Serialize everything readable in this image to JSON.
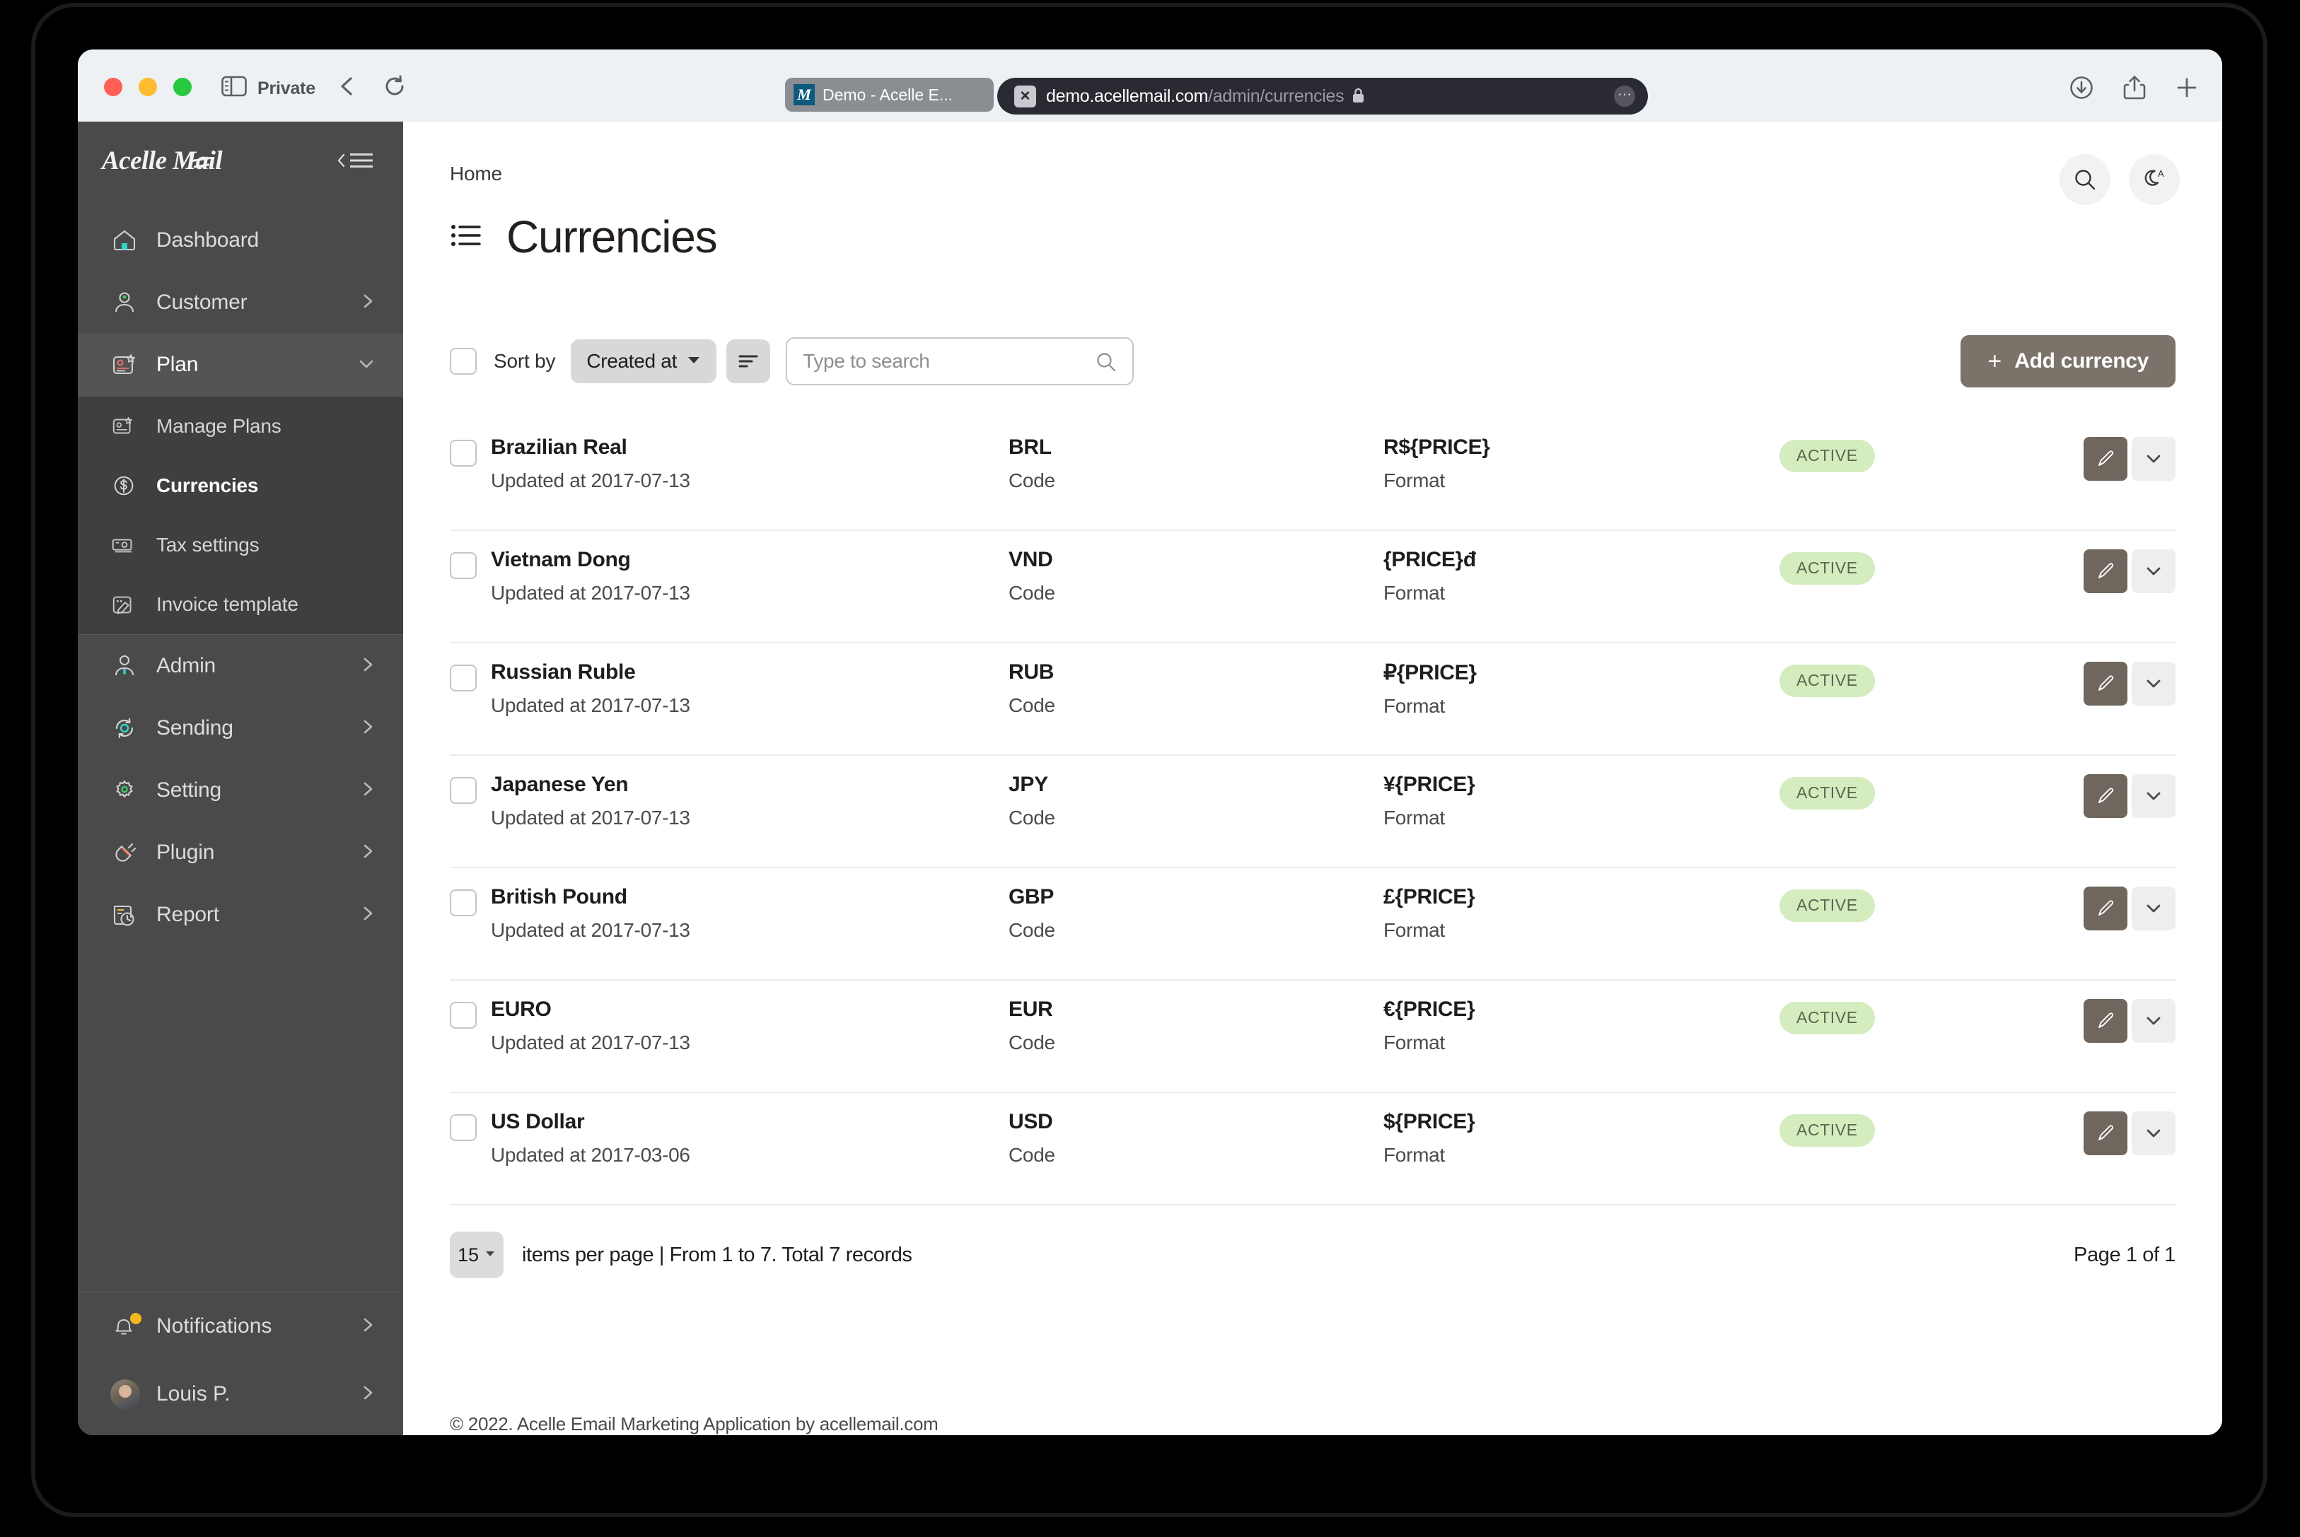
{
  "browser": {
    "private_label": "Private",
    "tab": {
      "favicon_letter": "M",
      "title": "Demo - Acelle E..."
    },
    "url": {
      "domain": "demo.acellemail.com",
      "path": "/admin/currencies"
    },
    "icons": {
      "sidebar_toggle": "sidebar-toggle-icon",
      "back": "back-chevron-icon",
      "reload": "reload-icon",
      "download": "download-icon",
      "share": "share-icon",
      "new_tab": "plus-icon"
    }
  },
  "sidebar": {
    "brand": "Acelle Mail",
    "collapse_icon": "collapse-menu-icon",
    "items": [
      {
        "label": "Dashboard",
        "icon": "home-icon",
        "arrow": ""
      },
      {
        "label": "Customer",
        "icon": "user-icon",
        "arrow": "chevron-right"
      },
      {
        "label": "Plan",
        "icon": "plan-card-icon",
        "arrow": "chevron-down"
      }
    ],
    "sub_items": [
      {
        "label": "Manage Plans",
        "icon": "plan-card-icon"
      },
      {
        "label": "Currencies",
        "icon": "dollar-circle-icon"
      },
      {
        "label": "Tax settings",
        "icon": "banknote-icon"
      },
      {
        "label": "Invoice template",
        "icon": "template-brush-icon"
      }
    ],
    "items_after": [
      {
        "label": "Admin",
        "icon": "admin-user-icon",
        "arrow": "chevron-right"
      },
      {
        "label": "Sending",
        "icon": "sending-sync-icon",
        "arrow": "chevron-right"
      },
      {
        "label": "Setting",
        "icon": "gear-icon",
        "arrow": "chevron-right"
      },
      {
        "label": "Plugin",
        "icon": "plug-icon",
        "arrow": "chevron-right"
      },
      {
        "label": "Report",
        "icon": "report-clock-icon",
        "arrow": "chevron-right"
      }
    ],
    "footer": [
      {
        "label": "Notifications",
        "icon": "bell-icon",
        "arrow": "chevron-right",
        "has_dot": true
      },
      {
        "label": "Louis P.",
        "icon": "avatar",
        "arrow": "chevron-right",
        "has_dot": false
      }
    ]
  },
  "header": {
    "breadcrumb": "Home",
    "title": "Currencies",
    "title_icon": "list-icon",
    "search_icon": "search-icon",
    "theme_icon": "moon-auto-icon"
  },
  "toolbar": {
    "sort_by_label": "Sort by",
    "sort_value": "Created at",
    "sort_direction_icon": "sort-direction-icon",
    "search_placeholder": "Type to search",
    "search_value": "",
    "search_icon": "search-icon",
    "add_button_label": "Add currency",
    "add_button_plus": "+",
    "add_button_color": "#7b7369"
  },
  "list": {
    "labels": {
      "code": "Code",
      "format": "Format",
      "updated_prefix": "Updated at"
    },
    "rows": [
      {
        "name": "Brazilian Real",
        "updated": "Updated at 2017-07-13",
        "code": "BRL",
        "code_label": "Code",
        "format": "R${PRICE}",
        "format_label": "Format",
        "status": "ACTIVE"
      },
      {
        "name": "Vietnam Dong",
        "updated": "Updated at 2017-07-13",
        "code": "VND",
        "code_label": "Code",
        "format": "{PRICE}đ",
        "format_label": "Format",
        "status": "ACTIVE"
      },
      {
        "name": "Russian Ruble",
        "updated": "Updated at 2017-07-13",
        "code": "RUB",
        "code_label": "Code",
        "format": "₽{PRICE}",
        "format_label": "Format",
        "status": "ACTIVE"
      },
      {
        "name": "Japanese Yen",
        "updated": "Updated at 2017-07-13",
        "code": "JPY",
        "code_label": "Code",
        "format": "¥{PRICE}",
        "format_label": "Format",
        "status": "ACTIVE"
      },
      {
        "name": "British Pound",
        "updated": "Updated at 2017-07-13",
        "code": "GBP",
        "code_label": "Code",
        "format": "£{PRICE}",
        "format_label": "Format",
        "status": "ACTIVE"
      },
      {
        "name": "EURO",
        "updated": "Updated at 2017-07-13",
        "code": "EUR",
        "code_label": "Code",
        "format": "€{PRICE}",
        "format_label": "Format",
        "status": "ACTIVE"
      },
      {
        "name": "US Dollar",
        "updated": "Updated at 2017-03-06",
        "code": "USD",
        "code_label": "Code",
        "format": "${PRICE}",
        "format_label": "Format",
        "status": "ACTIVE"
      }
    ],
    "status_badge_bg": "#d4ecbe",
    "edit_icon": "pencil-icon",
    "more_icon": "chevron-down-icon"
  },
  "pagination": {
    "per_page": "15",
    "text": "items per page  | From 1 to 7. Total 7 records",
    "page_indicator": "Page 1 of 1"
  },
  "footer": {
    "copyright": "© 2022. Acelle Email Marketing Application by acellemail.com"
  }
}
